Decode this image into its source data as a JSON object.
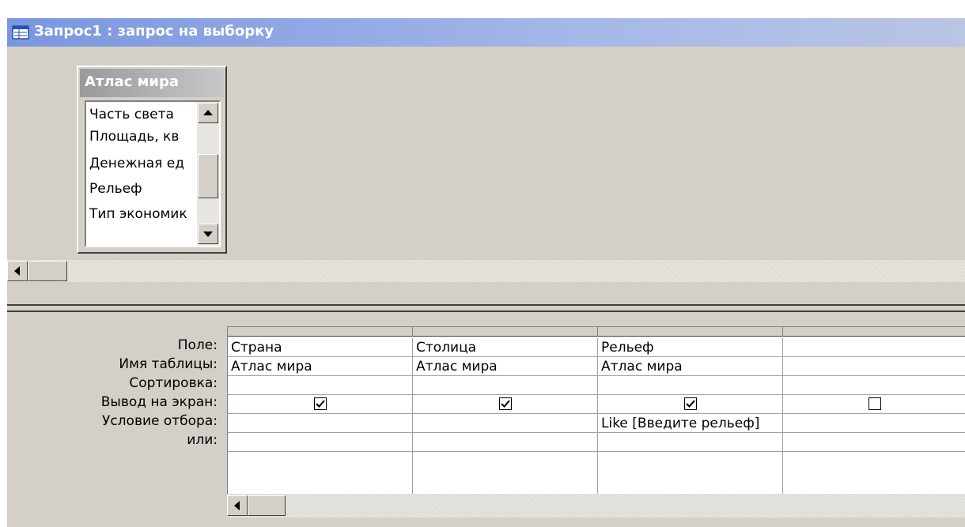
{
  "window": {
    "title": "Запрос1 : запрос на выборку"
  },
  "table_box": {
    "title": "Атлас мира",
    "fields": [
      "Часть света",
      "Площадь, кв",
      "Денежная ед",
      "Рельеф",
      "Тип экономик"
    ]
  },
  "grid": {
    "row_labels": {
      "field": "Поле:",
      "table": "Имя таблицы:",
      "sort": "Сортировка:",
      "show": "Вывод на экран:",
      "criteria": "Условие отбора:",
      "or": "или:"
    },
    "columns": [
      {
        "field": "Страна",
        "table": "Атлас мира",
        "sort": "",
        "show": true,
        "criteria": "",
        "or": ""
      },
      {
        "field": "Столица",
        "table": "Атлас мира",
        "sort": "",
        "show": true,
        "criteria": "",
        "or": ""
      },
      {
        "field": "Рельеф",
        "table": "Атлас мира",
        "sort": "",
        "show": true,
        "criteria": "Like [Введите рельеф]",
        "or": ""
      },
      {
        "field": "",
        "table": "",
        "sort": "",
        "show": false,
        "criteria": "",
        "or": ""
      }
    ]
  },
  "icons": {
    "title": "query-window-icon",
    "scroll_up": "arrow-up-icon",
    "scroll_down": "arrow-down-icon",
    "scroll_left": "arrow-left-icon",
    "checkbox_checked": "checkmark-icon"
  }
}
